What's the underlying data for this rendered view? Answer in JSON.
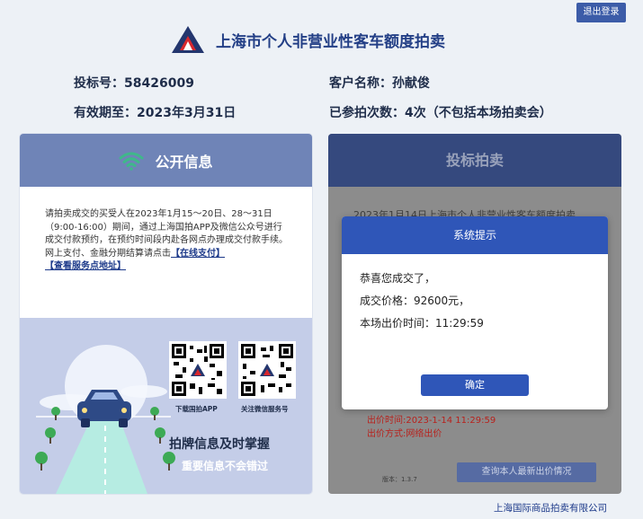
{
  "header": {
    "logout_label": "退出登录",
    "site_title": "上海市个人非营业性客车额度拍卖"
  },
  "account": {
    "bid_no_label": "投标号：",
    "bid_no": "58426009",
    "customer_label": "客户名称：",
    "customer_name": "孙献俊",
    "valid_label": "有效期至：",
    "valid_until": "2023年3月31日",
    "count_label": "已参拍次数：",
    "count_value": "4次（不包括本场拍卖会）"
  },
  "public_info": {
    "title": "公开信息",
    "notice_text": "请拍卖成交的买受人在2023年1月15～20日、28～31日（9:00-16:00）期间，通过上海国拍APP及微信公众号进行成交付款预约，在预约时间段内赴各网点办理成交付款手续。",
    "notice_text2": "网上支付、金融分期结算请点击",
    "online_pay_link": "【在线支付】",
    "service_point_link": "【查看服务点地址】",
    "qr_app_label": "下载国拍APP",
    "qr_wechat_label": "关注微信服务号",
    "slogan_main": "拍牌信息及时掌握",
    "slogan_sub": "重要信息不会错过"
  },
  "bid_panel": {
    "title": "投标拍卖",
    "background_text": "2023年1月14日上海市个人非营业性客车额度拍卖",
    "bid_time": "出价时间:2023-1-14 11:29:59",
    "bid_method": "出价方式:网络出价",
    "version": "版本：1.3.7",
    "query_button": "查询本人最新出价情况"
  },
  "modal": {
    "title": "系统提示",
    "line1": "恭喜您成交了，",
    "line2": "成交价格：92600元，",
    "line3": "本场出价时间：11:29:59",
    "confirm_label": "确定"
  },
  "footer": {
    "company": "上海国际商品拍卖有限公司"
  },
  "colors": {
    "brand_blue": "#2f56b8",
    "header_navy": "#35497e",
    "accent_red": "#b8211c",
    "wifi_green": "#3fb88a"
  }
}
